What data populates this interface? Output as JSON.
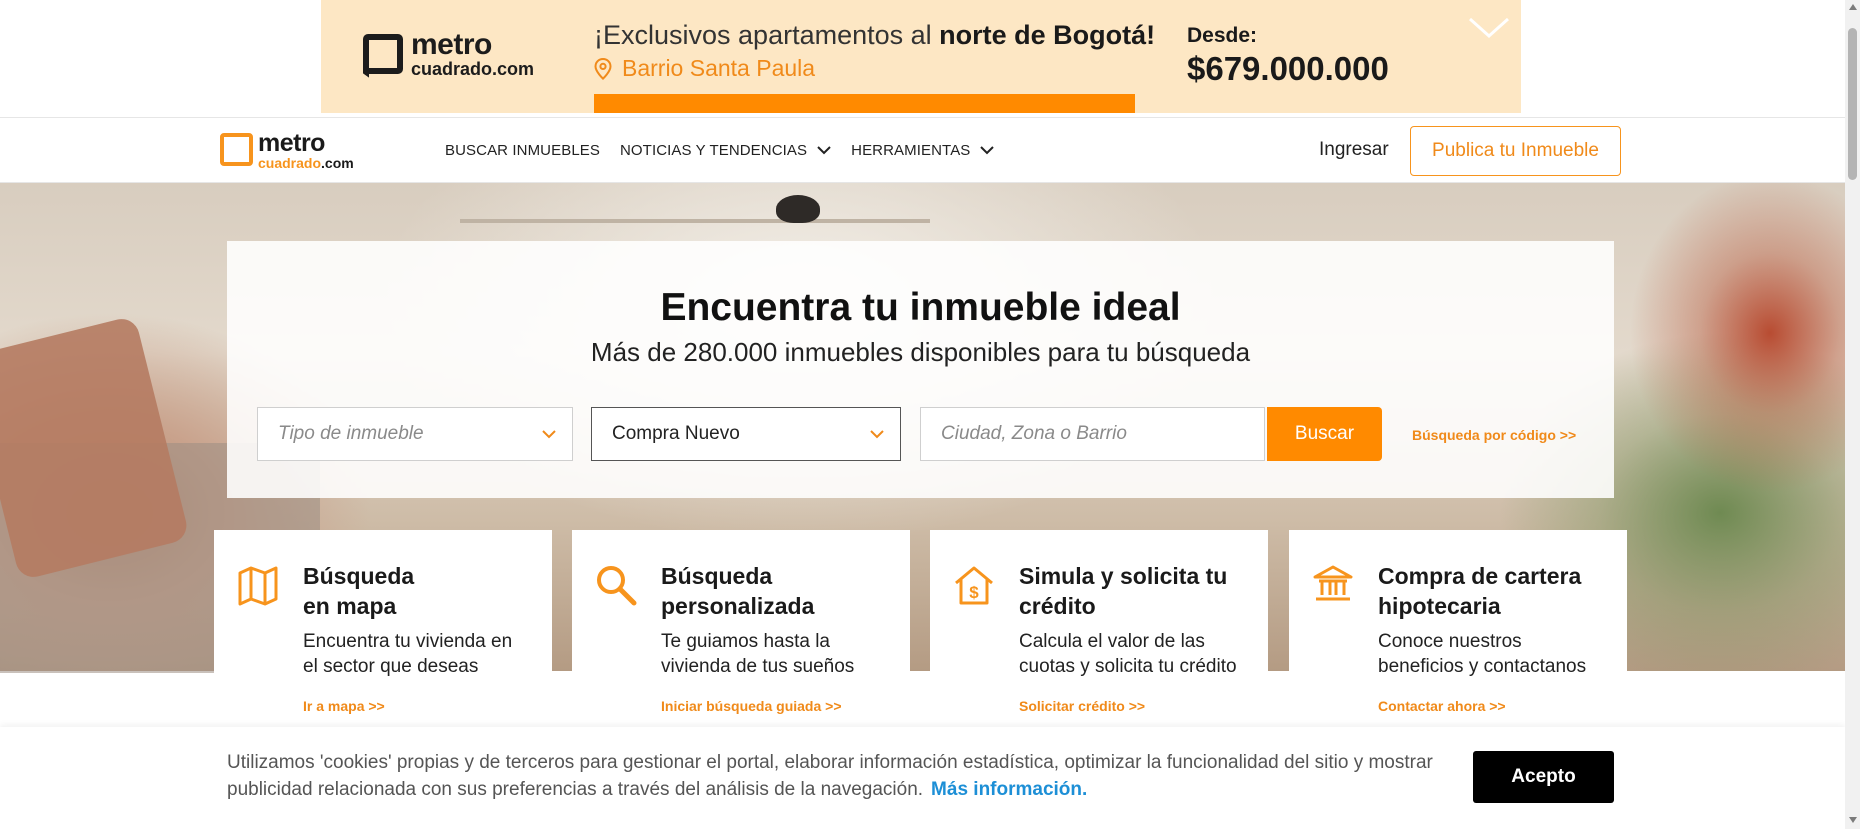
{
  "ad": {
    "logo_main": "metro",
    "logo_sub": "cuadrado.com",
    "headline_prefix": "¡Exclusivos apartamentos al ",
    "headline_bold": "norte de Bogotá!",
    "location": "Barrio Santa Paula",
    "from_label": "Desde:",
    "price": "$679.000.000",
    "icons": {
      "location": "map-pin-icon",
      "collapse": "chevron-down-icon"
    },
    "accent_color": "#ff8a00",
    "background_color": "#fde7c4"
  },
  "nav": {
    "logo_main": "metro",
    "logo_sub_a": "cuadrado",
    "logo_sub_b": ".com",
    "links": [
      {
        "label": "BUSCAR INMUEBLES",
        "has_dropdown": false
      },
      {
        "label": "NOTICIAS Y TENDENCIAS",
        "has_dropdown": true
      },
      {
        "label": "HERRAMIENTAS",
        "has_dropdown": true
      }
    ],
    "login": "Ingresar",
    "publish": "Publica tu Inmueble"
  },
  "search": {
    "title": "Encuentra tu inmueble ideal",
    "subtitle": "Más de 280.000 inmuebles disponibles para tu búsqueda",
    "type_placeholder": "Tipo de inmueble",
    "mode_value": "Compra Nuevo",
    "location_placeholder": "Ciudad, Zona o Barrio",
    "button": "Buscar",
    "code_link": "Búsqueda por código  >>"
  },
  "cards": [
    {
      "icon": "map-icon",
      "title_line1": "Búsqueda",
      "title_line2": "en mapa",
      "desc": "Encuentra tu vivienda en el sector que deseas",
      "link": "Ir a mapa  >>"
    },
    {
      "icon": "search-icon",
      "title_line1": "Búsqueda",
      "title_line2": "personalizada",
      "desc": "Te guiamos hasta la vivienda de tus sueños",
      "link": "Iniciar búsqueda guiada  >>"
    },
    {
      "icon": "house-dollar-icon",
      "title_line1": "Simula y solicita tu",
      "title_line2": "crédito",
      "desc": "Calcula el valor de las cuotas y solicita tu crédito",
      "link": "Solicitar crédito  >>"
    },
    {
      "icon": "bank-icon",
      "title_line1": "Compra de cartera",
      "title_line2": "hipotecaria",
      "desc": "Conoce nuestros beneficios y contactanos",
      "link": "Contactar ahora  >>"
    }
  ],
  "cookie": {
    "text": "Utilizamos 'cookies' propias y de terceros para gestionar el portal, elaborar información estadística, optimizar la funcionalidad del sitio y mostrar publicidad relacionada con sus preferencias a través del análisis de la navegación.",
    "more_link": "Más información.",
    "accept": "Acepto"
  },
  "colors": {
    "brand_orange": "#f7941d",
    "button_orange": "#ff8a00",
    "link_blue": "#1d8fd6"
  }
}
